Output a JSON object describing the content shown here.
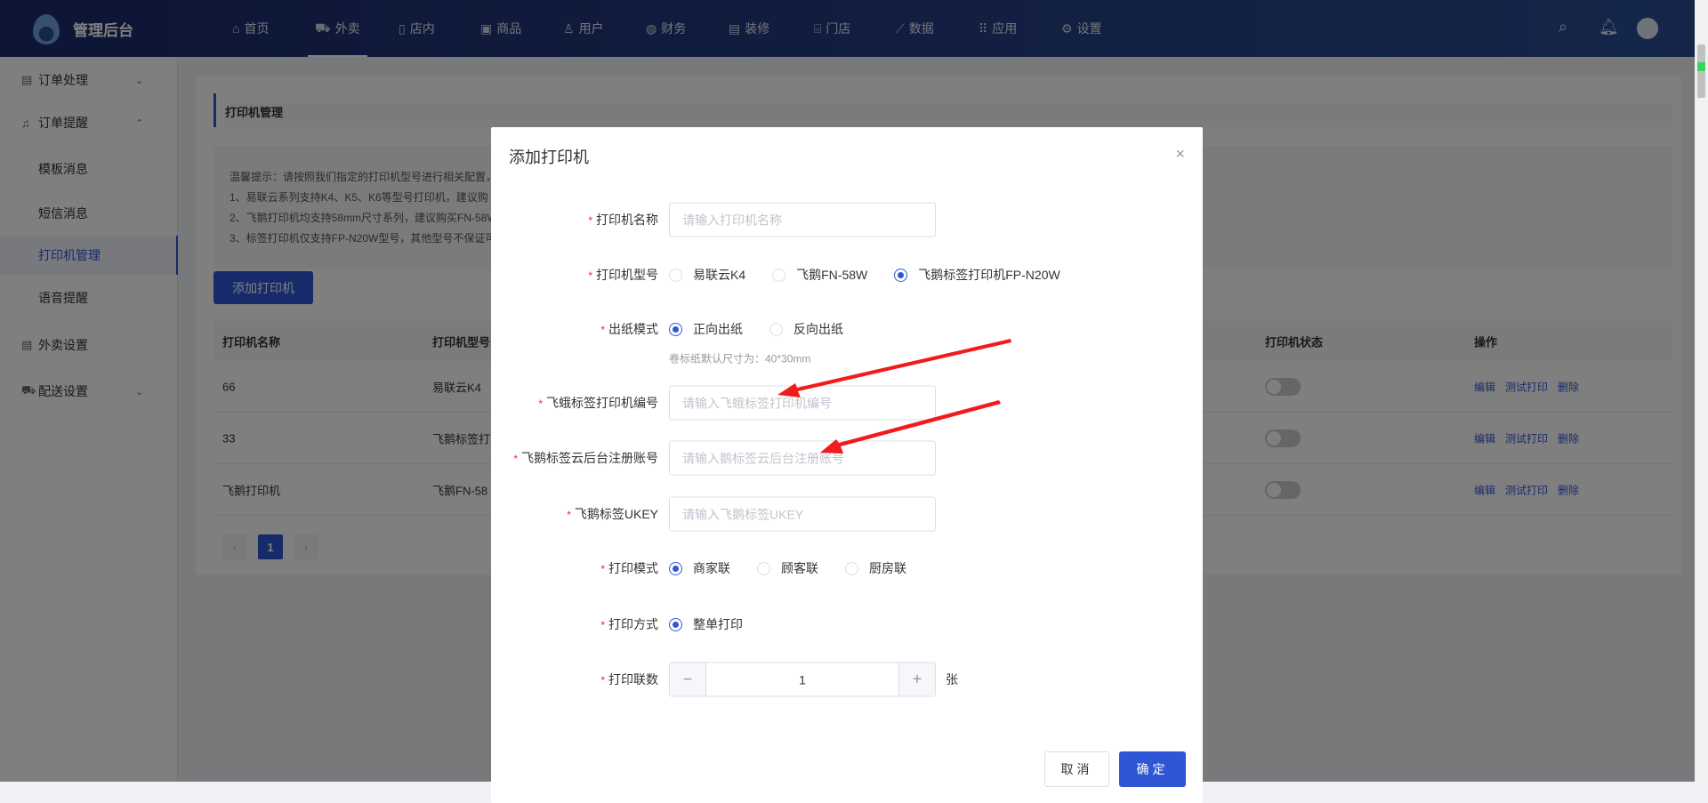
{
  "header": {
    "brand": "管理后台",
    "nav": [
      {
        "label": "首页",
        "icon": "home-icon",
        "glyph": "⌂"
      },
      {
        "label": "外卖",
        "icon": "delivery-icon",
        "glyph": "⛟",
        "active": true
      },
      {
        "label": "店内",
        "icon": "store-inside-icon",
        "glyph": "▯"
      },
      {
        "label": "商品",
        "icon": "goods-icon",
        "glyph": "▣"
      },
      {
        "label": "用户",
        "icon": "user-icon",
        "glyph": "♙"
      },
      {
        "label": "财务",
        "icon": "finance-icon",
        "glyph": "◍"
      },
      {
        "label": "装修",
        "icon": "decorate-icon",
        "glyph": "▤"
      },
      {
        "label": "门店",
        "icon": "shop-icon",
        "glyph": "⌸"
      },
      {
        "label": "数据",
        "icon": "chart-icon",
        "glyph": "⟋"
      },
      {
        "label": "应用",
        "icon": "apps-icon",
        "glyph": "⠿"
      },
      {
        "label": "设置",
        "icon": "gear-icon",
        "glyph": "⚙"
      }
    ]
  },
  "sidebar": {
    "items": [
      {
        "label": "订单处理",
        "glyph": "▤",
        "chev": "⌄"
      },
      {
        "label": "订单提醒",
        "glyph": "♫",
        "chev": "⌃"
      },
      {
        "label": "模板消息"
      },
      {
        "label": "短信消息"
      },
      {
        "label": "打印机管理",
        "active": true
      },
      {
        "label": "语音提醒"
      },
      {
        "label": "外卖设置",
        "glyph": "▤"
      },
      {
        "label": "配送设置",
        "glyph": "⛟",
        "chev": "⌄"
      }
    ]
  },
  "page": {
    "title": "打印机管理",
    "tips": [
      "温馨提示：请按照我们指定的打印机型号进行相关配置，",
      "1、易联云系列支持K4、K5、K6等型号打印机，建议购",
      "2、飞鹅打印机均支持58mm尺寸系列，建议购买FN-58W",
      "3、标签打印机仅支持FP-N20W型号，其他型号不保证可"
    ],
    "add_button": "添加打印机",
    "table": {
      "headers": [
        "打印机名称",
        "打印机型号",
        "打印机状态",
        "操作"
      ],
      "rows": [
        {
          "name": "66",
          "model": "易联云K4"
        },
        {
          "name": "33",
          "model": "飞鹅标签打"
        },
        {
          "name": "飞鹅打印机",
          "model": "飞鹅FN-58"
        }
      ],
      "ops": [
        "编辑",
        "测试打印",
        "删除"
      ]
    },
    "pagination": {
      "prev": "‹",
      "current": "1",
      "next": "›"
    }
  },
  "modal": {
    "title": "添加打印机",
    "close": "×",
    "fields": {
      "name": {
        "label": "打印机名称",
        "placeholder": "请输入打印机名称"
      },
      "model": {
        "label": "打印机型号",
        "options": [
          "易联云K4",
          "飞鹅FN-58W",
          "飞鹅标签打印机FP-N20W"
        ],
        "selected": 2
      },
      "paper": {
        "label": "出纸模式",
        "options": [
          "正向出纸",
          "反向出纸"
        ],
        "selected": 0,
        "hint": "卷标纸默认尺寸为：40*30mm"
      },
      "sn": {
        "label": "飞蛾标签打印机编号",
        "placeholder": "请输入飞蛾标签打印机编号"
      },
      "account": {
        "label": "飞鹅标签云后台注册账号",
        "placeholder": "请输入鹅标签云后台注册账号"
      },
      "ukey": {
        "label": "飞鹅标签UKEY",
        "placeholder": "请输入飞鹅标签UKEY"
      },
      "mode": {
        "label": "打印模式",
        "options": [
          "商家联",
          "顾客联",
          "厨房联"
        ],
        "selected": 0
      },
      "method": {
        "label": "打印方式",
        "options": [
          "整单打印"
        ],
        "selected": 0
      },
      "copies": {
        "label": "打印联数",
        "value": "1",
        "minus": "−",
        "plus": "+",
        "unit": "张"
      }
    },
    "cancel": "取消",
    "confirm": "确定"
  },
  "colors": {
    "primary": "#2f56d4",
    "arrow": "#f21b1b"
  }
}
